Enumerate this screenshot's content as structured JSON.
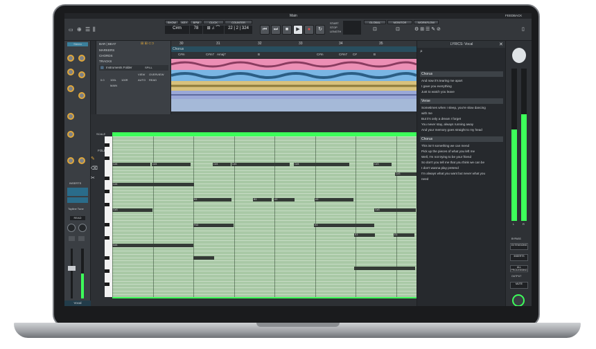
{
  "app": {
    "title": "Main",
    "feedback": "FEEDBACK"
  },
  "toolbar": {
    "show": "SHOW",
    "key": "KEY",
    "bpm": "BPM",
    "click": "CLICK",
    "counter": "COUNTER",
    "key_value": "C#m",
    "bpm_value": "78",
    "counter_value": "22 | 2 | 324",
    "start": "START",
    "stop": "STOP",
    "length": "LENGTH",
    "global": "GLOBAL",
    "monitor": "MONITOR",
    "workflow": "WORKFLOW"
  },
  "ruler": {
    "bar_beat": "BAR | BEAT",
    "bars": [
      "30",
      "31",
      "32",
      "33",
      "34",
      "35",
      "36"
    ]
  },
  "tracks": {
    "markers": "MARKERS",
    "chords": "CHORDS",
    "tracks": "TRACKS",
    "marker_chorus": "Chorus",
    "chords_list": [
      "C#m",
      "C#m7",
      "Amaj7",
      "B",
      "C#m",
      "C#m7",
      "C#",
      "B"
    ],
    "folder": "Instruments Folder",
    "spill": "SPILL",
    "view": "VIEW",
    "overview": "OVERVIEW",
    "auto": "AUTO",
    "read": "READ",
    "main": "MAIN",
    "vals": [
      "0.0",
      "100L",
      "100R"
    ]
  },
  "left": {
    "inserts": "INSERTS",
    "read": "READ",
    "vocal": "Vocal",
    "tape": "Topline Tune",
    "stereo": "Stereo"
  },
  "piano": {
    "scale": "SCALE",
    "fold": "FOLD",
    "keys_label": "Keys",
    "bar_labels": [
      "33",
      "33.3",
      "33.2",
      "34",
      "34.2",
      "34.3",
      "35",
      "35.2"
    ],
    "note_labels": [
      "C#4",
      "C#4",
      "C#4",
      "C#4",
      "C#4",
      "C#3",
      "C#3",
      "C#4",
      "B3",
      "B3",
      "A3",
      "A3",
      "G#3",
      "G#3",
      "F#3",
      "E3",
      "E3",
      "E3",
      "D#4"
    ]
  },
  "lyrics": {
    "title": "LYRICS: Vocal",
    "sections": [
      {
        "name": "Chorus",
        "lines": [
          "And now it's tearing me apart",
          "I gave you everything",
          "Just to watch you leave"
        ]
      },
      {
        "name": "Verse",
        "lines": [
          "Sometimes when I sleep, you're slow dancing",
          "with me",
          "But it's only a dream I forget",
          "You never stay, always running away",
          "And your memory goes straight to my head"
        ]
      },
      {
        "name": "Chorus",
        "lines": [
          "This isn't something we can mend",
          "Pick up the pieces of what you left me",
          "Well, I'm not trying to be your friend",
          "So don't you tell me that you think we can be",
          "I don't wanna play pretend",
          "I'm always what you want but never what you",
          "need"
        ]
      }
    ]
  },
  "meter": {
    "bypass": "BYPASS",
    "extensions": "EXTENSIONS",
    "inserts": "INSERTS",
    "all": "ALL PROCESSING",
    "output": "OUTPUT",
    "mute": "MUTE",
    "db": "0.0 dB",
    "l": "L",
    "r": "R"
  },
  "colors": {
    "accent": "#3dff5a",
    "pink": "#ec8fb5",
    "blue": "#7ab6e4",
    "yellow": "#d8c17c",
    "green": "#a9c9a6"
  }
}
